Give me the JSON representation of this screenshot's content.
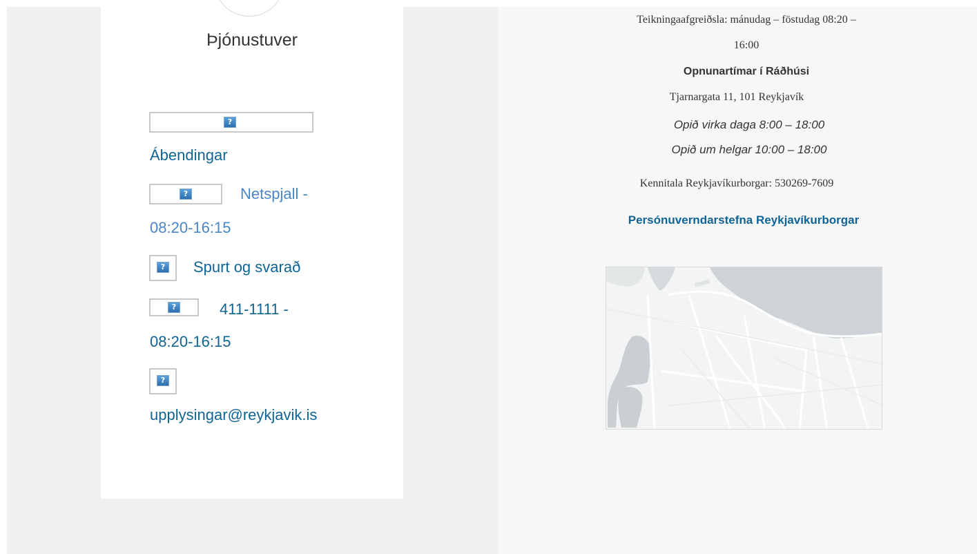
{
  "service_card": {
    "title": "Þjónustuver",
    "links": {
      "abendingar": "Ábendingar",
      "netspjall": "Netspjall -",
      "netspjall_hours": "08:20-16:15",
      "spurt": "Spurt og svarað",
      "phone": "411-1111 -",
      "phone_hours": "08:20-16:15",
      "email": "upplysingar@reykjavik.is"
    },
    "icon_placeholder": "?"
  },
  "contact_info": {
    "drawing_desk_line1": "Teikningaafgreiðsla: mánudag – föstudag 08:20 –",
    "drawing_desk_line2": "16:00",
    "city_hall_heading": "Opnunartímar í Ráðhúsi",
    "address": "Tjarnargata 11, 101 Reykjavík",
    "weekday_hours": "Opið virka daga 8:00 – 18:00",
    "weekend_hours": "Opið um helgar 10:00  – 18:00",
    "kennitala": "Kennitala Reykjavíkurborgar: 530269-7609",
    "privacy_link": "Persónuverndarstefna Reykjavíkurborgar"
  },
  "colors": {
    "link": "#106493",
    "link_light": "#4a86c6",
    "panel_left": "#f0f0f0",
    "panel_right": "#f7f7f7",
    "map_water": "#cdd3d6",
    "map_land": "#f3f4f4"
  },
  "map": {
    "icon": "map-icon"
  }
}
